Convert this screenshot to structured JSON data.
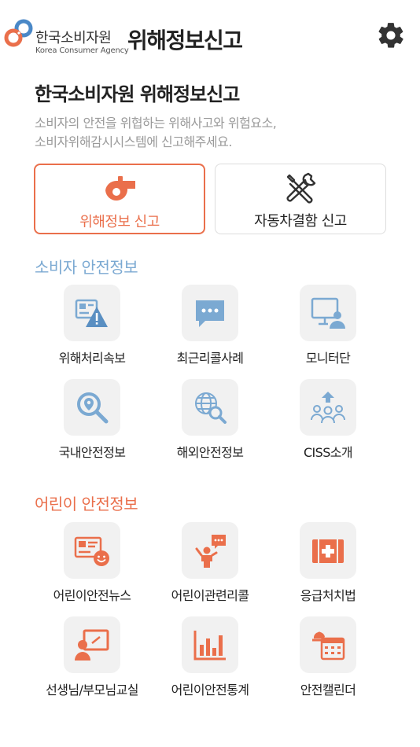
{
  "header": {
    "org_name_ko": "한국소비자원",
    "org_name_en": "Korea Consumer Agency",
    "service_title": "위해정보신고",
    "settings_icon": "gear-icon"
  },
  "intro": {
    "title": "한국소비자원 위해정보신고",
    "desc_line1": "소비자의 안전을 위협하는 위해사고와 위험요소,",
    "desc_line2": "소비자위해감시시스템에 신고해주세요."
  },
  "reports": {
    "hazard_label": "위해정보 신고",
    "hazard_icon": "whistle-icon",
    "car_label": "자동차결함 신고",
    "car_icon": "tools-icon"
  },
  "consumer_section": {
    "title": "소비자 안전정보",
    "items": [
      {
        "label": "위해처리속보",
        "icon": "warning-news-icon"
      },
      {
        "label": "최근리콜사례",
        "icon": "chat-bubble-icon"
      },
      {
        "label": "모니터단",
        "icon": "monitor-person-icon"
      },
      {
        "label": "국내안전정보",
        "icon": "magnifier-location-icon"
      },
      {
        "label": "해외안전정보",
        "icon": "globe-search-icon"
      },
      {
        "label": "CISS소개",
        "icon": "group-people-icon"
      }
    ]
  },
  "child_section": {
    "title": "어린이 안전정보",
    "items": [
      {
        "label": "어린이안전뉴스",
        "icon": "news-smile-icon"
      },
      {
        "label": "어린이관련리콜",
        "icon": "child-speech-icon"
      },
      {
        "label": "응급처치법",
        "icon": "first-aid-kit-icon"
      },
      {
        "label": "선생님/부모님교실",
        "icon": "teacher-board-icon"
      },
      {
        "label": "어린이안전통계",
        "icon": "bar-chart-icon"
      },
      {
        "label": "안전캘린더",
        "icon": "calendar-icon"
      }
    ]
  },
  "colors": {
    "accent_orange": "#ea6f4b",
    "accent_blue": "#7ba9d2",
    "tile_bg": "#f1f1f1"
  }
}
